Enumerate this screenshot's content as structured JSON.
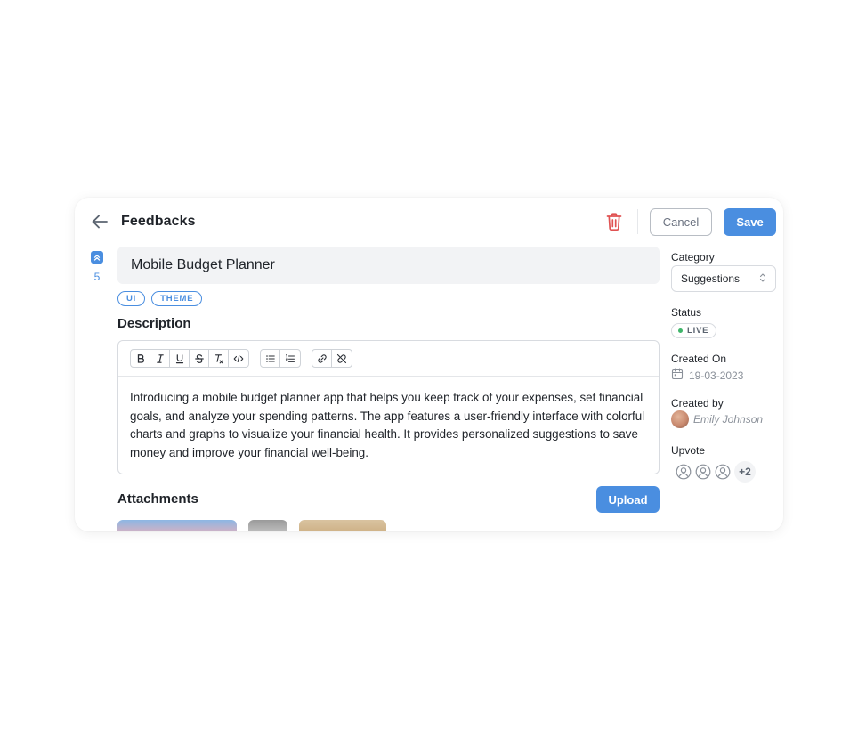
{
  "header": {
    "title": "Feedbacks",
    "cancel_label": "Cancel",
    "save_label": "Save"
  },
  "upvote": {
    "count": "5"
  },
  "feedback": {
    "title": "Mobile Budget Planner",
    "tags": [
      "UI",
      "THEME"
    ]
  },
  "description": {
    "heading": "Description",
    "toolbar": {
      "format": [
        "bold",
        "italic",
        "underline",
        "strikethrough",
        "clear-format",
        "code"
      ],
      "lists": [
        "bullet-list",
        "numbered-list"
      ],
      "links": [
        "link",
        "unlink"
      ]
    },
    "body": "Introducing a mobile budget planner app that helps you keep track of your expenses, set financial goals, and analyze your spending patterns. The app features a user-friendly interface with colorful charts and graphs to visualize your financial health. It provides personalized suggestions to save money and improve your financial well-being."
  },
  "attachments": {
    "heading": "Attachments",
    "upload_label": "Upload"
  },
  "sidebar": {
    "category_label": "Category",
    "category_value": "Suggestions",
    "status_label": "Status",
    "status_value": "LIVE",
    "created_on_label": "Created On",
    "created_on_value": "19-03-2023",
    "created_by_label": "Created by",
    "created_by_value": "Emily Johnson",
    "upvote_label": "Upvote",
    "upvote_more": "+2"
  },
  "colors": {
    "accent": "#4a8ee0",
    "danger": "#e05252",
    "live": "#3fb56a"
  }
}
